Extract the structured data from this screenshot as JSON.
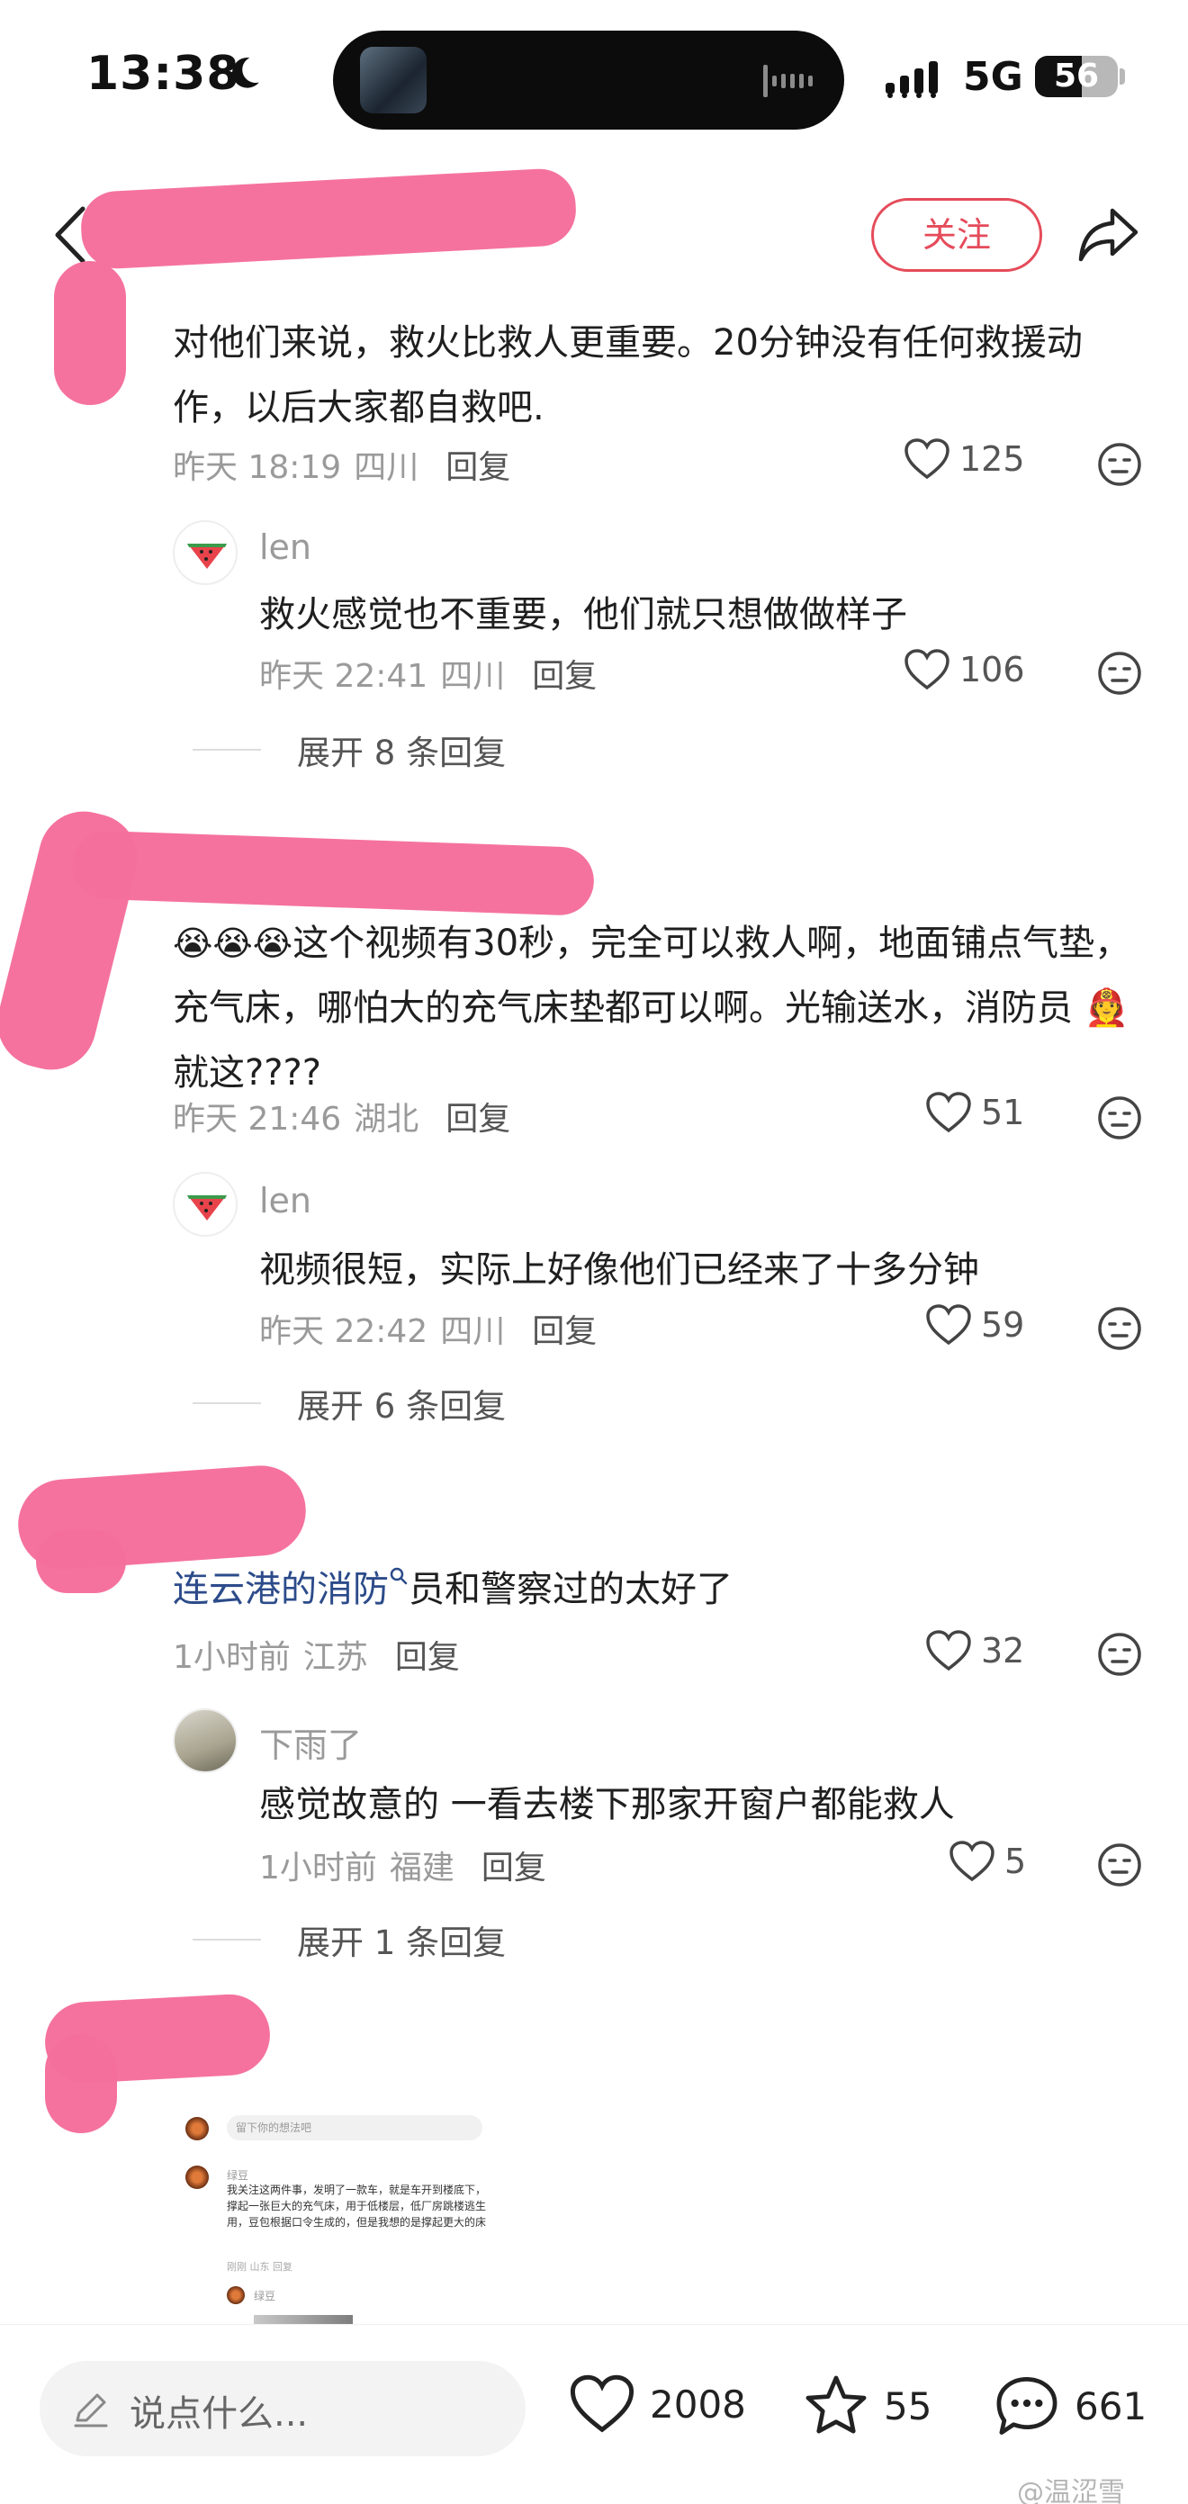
{
  "status_bar": {
    "time": "13:38",
    "network": "5G",
    "battery": "56",
    "battery_level_percent": 56,
    "icons": [
      "moon-icon",
      "signal-icon",
      "battery-icon"
    ]
  },
  "header": {
    "follow_label": "关注",
    "icons": [
      "chevron-left-icon",
      "share-icon"
    ]
  },
  "comments": [
    {
      "text": "对他们来说，救火比救人更重要。20分钟没有任何救援动作，以后大家都自救吧.",
      "time": "昨天 18:19",
      "location": "四川",
      "reply_label": "回复",
      "likes": "125",
      "reply": {
        "username": "len",
        "text": "救火感觉也不重要，他们就只想做做样子",
        "time": "昨天 22:41",
        "location": "四川",
        "reply_label": "回复",
        "likes": "106"
      },
      "expand_label": "展开 8 条回复"
    },
    {
      "text": "这个视频有30秒，完全可以救人啊，地面铺点气垫，充气床，哪怕大的充气床垫都可以啊。光输送水，消防员",
      "text_tail": "就这????",
      "time": "昨天 21:46",
      "location": "湖北",
      "reply_label": "回复",
      "likes": "51",
      "reply": {
        "username": "len",
        "text": "视频很短，实际上好像他们已经来了十多分钟",
        "time": "昨天 22:42",
        "location": "四川",
        "reply_label": "回复",
        "likes": "59"
      },
      "expand_label": "展开 6 条回复"
    },
    {
      "link_text": "连云港的消防",
      "text": "员和警察过的太好了",
      "time": "1小时前",
      "location": "江苏",
      "reply_label": "回复",
      "likes": "32",
      "reply": {
        "username": "下雨了",
        "text": "感觉故意的 一看去楼下那家开窗户都能救人",
        "time": "1小时前",
        "location": "福建",
        "reply_label": "回复",
        "likes": "5"
      },
      "expand_label": "展开 1 条回复"
    }
  ],
  "embedded_screenshot": {
    "input_placeholder": "留下你的想法吧",
    "name": "绿豆",
    "text": "我关注这两件事，发明了一款车，就是车开到楼底下，撑起一张巨大的充气床，用于低楼层，低厂房跳楼逃生用，豆包根据口令生成的，但是我想的是撑起更大的床",
    "meta": "刚刚 山东  回复",
    "reply_name": "绿豆"
  },
  "bottom_bar": {
    "input_placeholder": "说点什么...",
    "likes": "2008",
    "favorites": "55",
    "comments": "661"
  },
  "watermark": "@温涩雪",
  "colors": {
    "accent": "#e54b5a",
    "redaction": "#f56f9d",
    "link": "#2c4b8a"
  }
}
